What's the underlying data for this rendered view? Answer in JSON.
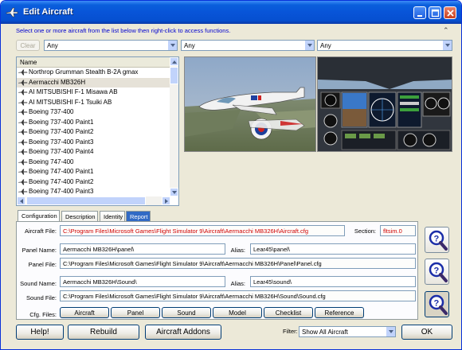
{
  "window": {
    "title": "Edit Aircraft"
  },
  "instruction": "Select one or more aircraft from the list below then right-click to access functions.",
  "top_controls": {
    "clear_label": "Clear",
    "filter1": "Any",
    "filter2": "Any",
    "filter3": "Any"
  },
  "list": {
    "header": "Name",
    "items": [
      "Northrop Grumman Stealth B-2A gmax",
      "Aermacchi MB326H",
      "AI MITSUBISHI F-1 Misawa AB",
      "AI MITSUBISHI F-1 Tsuiki AB",
      "Boeing 737-400",
      "Boeing 737-400 Paint1",
      "Boeing 737-400 Paint2",
      "Boeing 737-400 Paint3",
      "Boeing 737-400 Paint4",
      "Boeing 747-400",
      "Boeing 747-400 Paint1",
      "Boeing 747-400 Paint2",
      "Boeing 747-400 Paint3"
    ],
    "selected_index": 1
  },
  "tabs": [
    "Configuration",
    "Description",
    "Identity",
    "Report"
  ],
  "active_tab": "Configuration",
  "config": {
    "aircraft_file_label": "Aircraft File:",
    "aircraft_file": "C:\\Program Files\\Microsoft Games\\Flight Simulator 9\\Aircraft\\Aermacchi MB326H\\Aircraft.cfg",
    "section_label": "Section:",
    "section_value": "fltsim.0",
    "panel_name_label": "Panel Name:",
    "panel_name": "Aermacchi MB326H\\panel\\",
    "panel_alias_label": "Alias:",
    "panel_alias": "Lear45\\panel\\",
    "panel_file_label": "Panel File:",
    "panel_file": "C:\\Program Files\\Microsoft Games\\Flight Simulator 9\\Aircraft\\Aermacchi MB326H\\Panel\\Panel.cfg",
    "sound_name_label": "Sound Name:",
    "sound_name": "Aermacchi MB326H\\Sound\\",
    "sound_alias_label": "Alias:",
    "sound_alias": "Lear45\\sound\\",
    "sound_file_label": "Sound File:",
    "sound_file": "C:\\Program Files\\Microsoft Games\\Flight Simulator 9\\Aircraft\\Aermacchi MB326H\\Sound\\Sound.cfg",
    "cfg_files_label": "Cfg. Files:",
    "cfg_buttons": [
      "Aircraft",
      "Panel",
      "Sound",
      "Model",
      "Checklist",
      "Reference"
    ]
  },
  "bottom": {
    "help_label": "Help!",
    "rebuild_label": "Rebuild",
    "addons_label": "Aircraft Addons",
    "filter_label": "Filter:",
    "filter_value": "Show All Aircraft",
    "ok_label": "OK"
  },
  "colors": {
    "title_bar": "#0854d8",
    "instruction_text": "#0000d0",
    "path_text_red": "#d00000",
    "selection": "#316ac5"
  }
}
